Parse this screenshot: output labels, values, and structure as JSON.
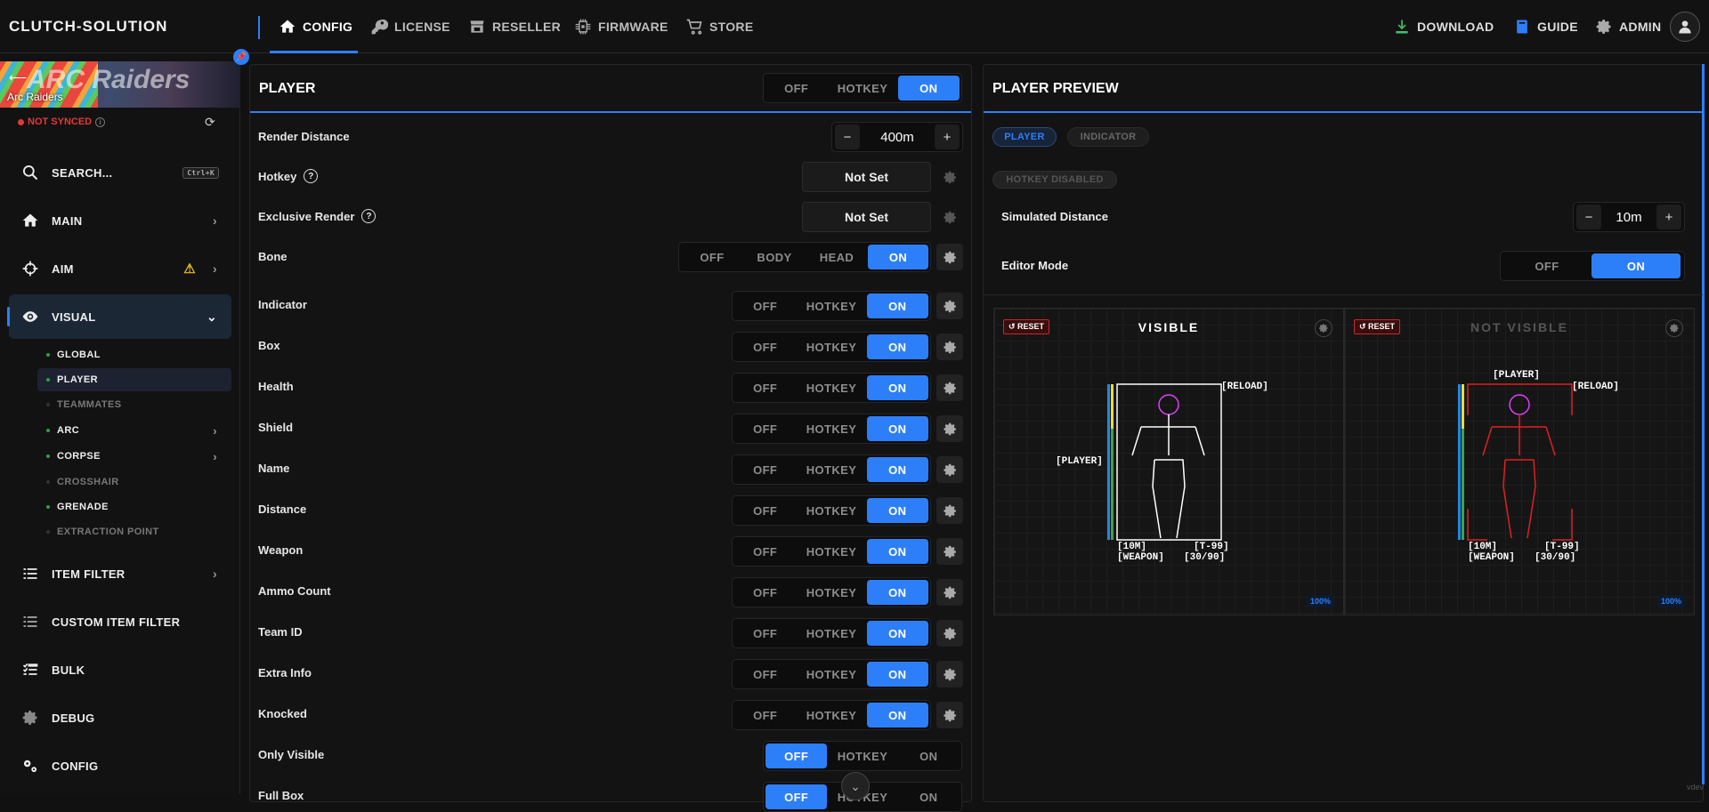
{
  "app": {
    "brand": "CLUTCH-SOLUTION",
    "footer": "vdev"
  },
  "topnav": {
    "left": [
      {
        "label": "CONFIG",
        "icon": "home-icon",
        "active": true
      },
      {
        "label": "LICENSE",
        "icon": "key-icon"
      },
      {
        "label": "RESELLER",
        "icon": "store-icon"
      },
      {
        "label": "FIRMWARE",
        "icon": "chip-icon"
      },
      {
        "label": "STORE",
        "icon": "cart-icon"
      }
    ],
    "right": [
      {
        "label": "DOWNLOAD",
        "icon": "download-icon"
      },
      {
        "label": "GUIDE",
        "icon": "book-icon"
      },
      {
        "label": "ADMIN",
        "icon": "gear-icon"
      }
    ]
  },
  "sidebar": {
    "game": "Arc Raiders",
    "banner_text": "ARC Raiders",
    "sync_status": "NOT SYNCED",
    "search_label": "SEARCH...",
    "search_shortcut": "Ctrl+K",
    "items": [
      {
        "label": "MAIN",
        "icon": "home-icon"
      },
      {
        "label": "AIM",
        "icon": "crosshair-icon",
        "warning": true
      },
      {
        "label": "VISUAL",
        "icon": "eye-icon",
        "active": true
      },
      {
        "label": "ITEM FILTER",
        "icon": "list-icon"
      },
      {
        "label": "CUSTOM ITEM FILTER",
        "icon": "list-icon"
      },
      {
        "label": "BULK",
        "icon": "checklist-icon"
      },
      {
        "label": "DEBUG",
        "icon": "gear-icon"
      },
      {
        "label": "CONFIG",
        "icon": "gears-icon"
      }
    ],
    "visual_sub": [
      {
        "label": "GLOBAL",
        "enabled": true
      },
      {
        "label": "PLAYER",
        "enabled": true,
        "active": true
      },
      {
        "label": "TEAMMATES",
        "enabled": false
      },
      {
        "label": "ARC",
        "enabled": true,
        "has_children": true
      },
      {
        "label": "CORPSE",
        "enabled": true,
        "has_children": true
      },
      {
        "label": "CROSSHAIR",
        "enabled": false
      },
      {
        "label": "GRENADE",
        "enabled": true
      },
      {
        "label": "EXTRACTION POINT",
        "enabled": false
      }
    ]
  },
  "player_panel": {
    "title": "PLAYER",
    "header_toggle": {
      "options": [
        "OFF",
        "HOTKEY",
        "ON"
      ],
      "selected": "ON"
    },
    "render_distance": {
      "label": "Render Distance",
      "value": "400m",
      "minus": "−",
      "plus": "+"
    },
    "hotkey": {
      "label": "Hotkey",
      "value": "Not Set",
      "help": "?"
    },
    "exclusive_render": {
      "label": "Exclusive Render",
      "value": "Not Set",
      "help": "?"
    },
    "bone": {
      "label": "Bone",
      "options": [
        "OFF",
        "BODY",
        "HEAD",
        "ON"
      ],
      "selected": "ON"
    },
    "rows": [
      {
        "label": "Indicator",
        "selected": "ON"
      },
      {
        "label": "Box",
        "selected": "ON"
      },
      {
        "label": "Health",
        "selected": "ON"
      },
      {
        "label": "Shield",
        "selected": "ON"
      },
      {
        "label": "Name",
        "selected": "ON"
      },
      {
        "label": "Distance",
        "selected": "ON"
      },
      {
        "label": "Weapon",
        "selected": "ON"
      },
      {
        "label": "Ammo Count",
        "selected": "ON"
      },
      {
        "label": "Team ID",
        "selected": "ON"
      },
      {
        "label": "Extra Info",
        "selected": "ON"
      },
      {
        "label": "Knocked",
        "selected": "ON"
      },
      {
        "label": "Only Visible",
        "selected": "OFF",
        "no_gear": true
      },
      {
        "label": "Full Box",
        "selected": "OFF",
        "no_gear": true
      }
    ],
    "row_options": [
      "OFF",
      "HOTKEY",
      "ON"
    ]
  },
  "preview_panel": {
    "title": "PLAYER PREVIEW",
    "tabs": [
      {
        "label": "PLAYER",
        "active": true
      },
      {
        "label": "INDICATOR",
        "active": false
      }
    ],
    "hotkey_badge": "HOTKEY DISABLED",
    "simulated_distance": {
      "label": "Simulated Distance",
      "value": "10m",
      "minus": "−",
      "plus": "+"
    },
    "editor_mode": {
      "label": "Editor Mode",
      "options": [
        "OFF",
        "ON"
      ],
      "selected": "ON"
    },
    "viewports": [
      {
        "title": "VISIBLE",
        "reset": "RESET",
        "zoom": "100%",
        "color": "#ffffff",
        "skeleton_color": "#ffffff",
        "labels": {
          "player": "[PLAYER]",
          "reload": "[RELOAD]",
          "distance": "[10M]",
          "team": "[T-99]",
          "weapon": "[WEAPON]",
          "ammo": "[30/90]"
        }
      },
      {
        "title": "NOT VISIBLE",
        "reset": "RESET",
        "zoom": "100%",
        "color": "#555555",
        "skeleton_color": "#e02020",
        "labels": {
          "player": "[PLAYER]",
          "reload": "[RELOAD]",
          "distance": "[10M]",
          "team": "[T-99]",
          "weapon": "[WEAPON]",
          "ammo": "[30/90]"
        }
      }
    ]
  },
  "colors": {
    "accent": "#2d7ff9",
    "warning": "#f0b429",
    "error": "#e53935",
    "bg": "#111111"
  }
}
